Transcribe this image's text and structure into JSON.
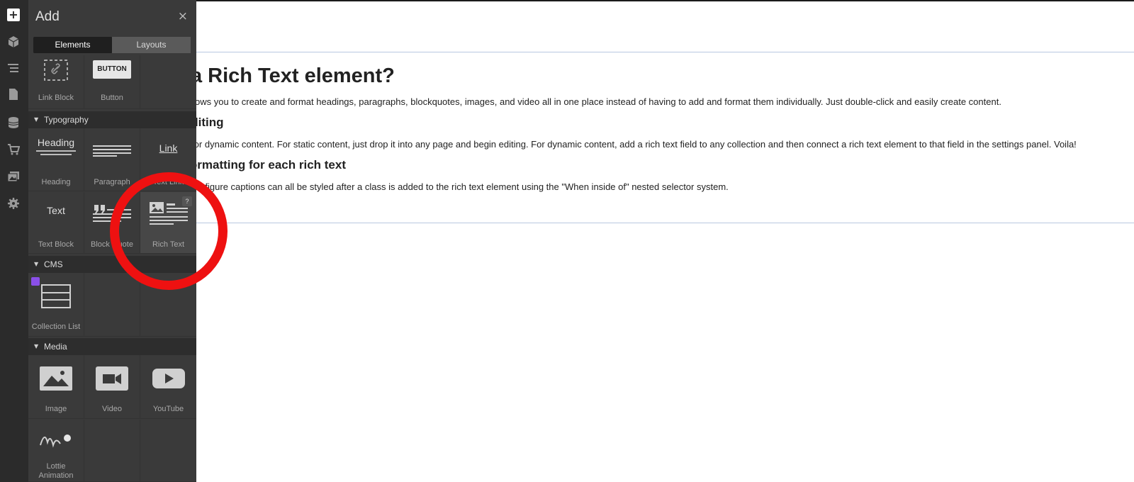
{
  "toolbar": {
    "icons": [
      "add-icon",
      "cube-icon",
      "navigator-icon",
      "pages-icon",
      "cms-icon",
      "ecommerce-icon",
      "assets-icon",
      "settings-icon"
    ]
  },
  "panel": {
    "title": "Add",
    "close": "×",
    "tabs": {
      "elements": "Elements",
      "layouts": "Layouts"
    },
    "basic": {
      "link_block": "Link Block",
      "button": "Button",
      "button_glyph": "BUTTON"
    },
    "typography": {
      "section": "Typography",
      "heading": "Heading",
      "heading_glyph": "Heading",
      "paragraph": "Paragraph",
      "text_link": "Text Link",
      "link_glyph": "Link",
      "text_block": "Text Block",
      "text_glyph": "Text",
      "block_quote": "Block Quote",
      "rich_text": "Rich Text",
      "help": "?"
    },
    "cms": {
      "section": "CMS",
      "collection_list": "Collection List"
    },
    "media": {
      "section": "Media",
      "image": "Image",
      "video": "Video",
      "youtube": "YouTube",
      "lottie_line1": "Lottie",
      "lottie_line2": "Animation"
    }
  },
  "canvas": {
    "heading": "What's a Rich Text element?",
    "p1": "The rich text element allows you to create and format headings, paragraphs, blockquotes, images, and video all in one place instead of having to add and format them individually. Just double-click and easily create content.",
    "h3_1": "Static and dynamic content editing",
    "p2": "A rich text element can be used with static or dynamic content. For static content, just drop it into any page and begin editing. For dynamic content, add a rich text field to any collection and then connect a rich text element to that field in the settings panel. Voila!",
    "h3_2": "How to customize formatting for each rich text",
    "p3": "Headings, paragraphs, blockquotes, figures, images, and figure captions can all be styled after a class is added to the rich text element using the \"When inside of\" nested selector system."
  },
  "colors": {
    "highlight_ring": "#ee1111",
    "cms_badge": "#8a4fe8"
  }
}
